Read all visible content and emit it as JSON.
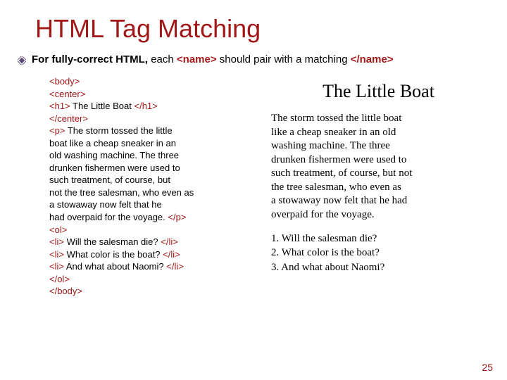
{
  "title": "HTML Tag Matching",
  "bullet": {
    "pre": "For fully-correct HTML, ",
    "each": "each ",
    "open": "<name>",
    "mid": " should pair with a matching ",
    "close": "</name>"
  },
  "code": {
    "l1": "<body>",
    "l2": "<center>",
    "l3a": "<h1>",
    "l3b": " The Little Boat ",
    "l3c": "</h1>",
    "l4": "</center>",
    "l5a": "<p>",
    "l5b": " The storm tossed the little",
    "l6": "boat like a cheap sneaker in an",
    "l7": "old washing machine. The three",
    "l8": "drunken fishermen were used to",
    "l9": "such treatment, of course, but",
    "l10": "not the tree salesman, who even as",
    "l11": "a stowaway now felt that he",
    "l12a": "had overpaid for the voyage. ",
    "l12b": "</p>",
    "l13": "<ol>",
    "l14a": "<li>",
    "l14b": " Will the salesman die? ",
    "l14c": "</li>",
    "l15a": "<li>",
    "l15b": " What color is the boat? ",
    "l15c": "</li>",
    "l16a": "<li>",
    "l16b": " And what about Naomi? ",
    "l16c": "</li>",
    "l17": "</ol>",
    "l18": "</body>"
  },
  "rendered": {
    "title": "The Little Boat",
    "p1": "The storm tossed the little boat",
    "p2": "like a cheap sneaker in an old",
    "p3": "washing machine. The three",
    "p4": "drunken fishermen were used to",
    "p5": "such treatment, of course, but not",
    "p6": "the tree salesman, who even as",
    "p7": "a stowaway now felt that he had",
    "p8": "overpaid for the voyage.",
    "li1": "1. Will the salesman die?",
    "li2": "2. What color is the boat?",
    "li3": "3. And what about Naomi?"
  },
  "page_number": "25"
}
